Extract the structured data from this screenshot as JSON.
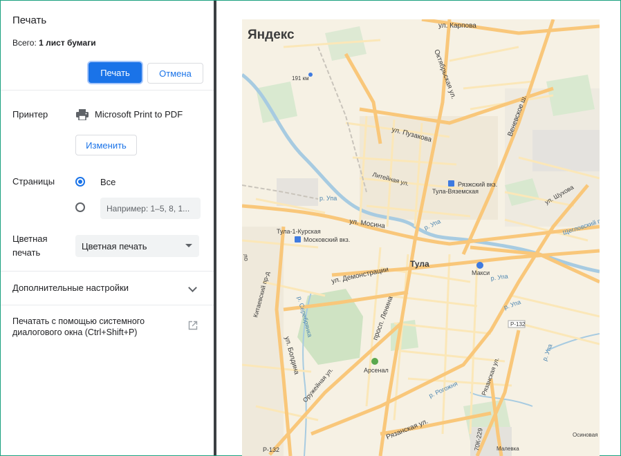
{
  "dialog": {
    "title": "Печать",
    "summary_prefix": "Всего: ",
    "summary_value": "1 лист бумаги",
    "print_label": "Печать",
    "cancel_label": "Отмена"
  },
  "printer": {
    "label": "Принтер",
    "name": "Microsoft Print to PDF",
    "change_label": "Изменить",
    "icon": "printer-icon"
  },
  "pages": {
    "label": "Страницы",
    "all_label": "Все",
    "custom_placeholder": "Например: 1–5, 8, 1..."
  },
  "color": {
    "label_line1": "Цветная",
    "label_line2": "печать",
    "selected": "Цветная печать"
  },
  "more_settings": {
    "label": "Дополнительные настройки",
    "icon": "chevron-down-icon"
  },
  "system_dialog": {
    "label": "Печатать с помощью системного диалогового окна (Ctrl+Shift+P)",
    "icon": "open-in-new-icon"
  },
  "map": {
    "logo": "Яндекс",
    "city": "Тула",
    "labels": {
      "karpova": "ул. Карпова",
      "oktyabrskaya": "Октябрьская ул.",
      "venevskoe": "Веневское ш.",
      "km191": "191 км",
      "puzakova": "ул. Пузакова",
      "liteinaya": "Литейная ул.",
      "ryazhsky": "Рязжский вкз.",
      "tula_vyazemskaya": "Тула-Вяземская",
      "upa1": "р. Упа",
      "upa2": "р. Упа",
      "upa3": "р. Упа",
      "upa4": "р. Упа",
      "shukhova": "ул. Шухова",
      "tsgelovsky": "Щегловский пр.",
      "mosina": "ул. Мосина",
      "tula1": "Тула-1-Курская",
      "moskovsky": "Московский вкз.",
      "maksi": "Макси",
      "demonstratsii": "ул. Демонстрации",
      "kitaevsky": "Китаевский пр-д",
      "serebryanka": "р. Серебрянка",
      "lenina": "просп. Ленина",
      "boldina": "ул. Болдина",
      "r132a": "Р-132",
      "ryazanskaya_v": "Рязанская ул.",
      "arsenal": "Арсенал",
      "oruzheinaya": "Оружейная ул.",
      "rogozhnya": "р. Рогожня",
      "ryazanskaya_h": "Рязанская ул.",
      "r132b": "Р-132",
      "ok229": "70К-229",
      "malevka": "Малевка",
      "osinovaya": "Осиновая",
      "upa5": "р. Упа",
      "partial_left": "ло"
    }
  }
}
